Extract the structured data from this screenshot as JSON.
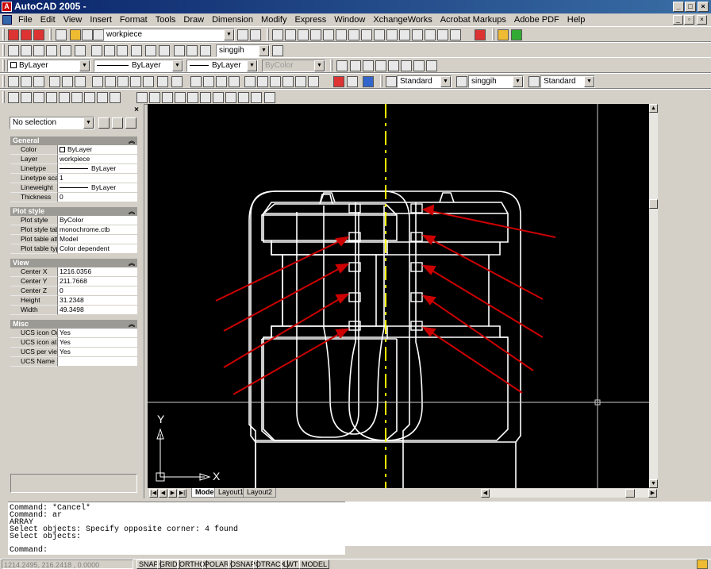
{
  "window": {
    "title": "AutoCAD 2005 -",
    "minimize": "_",
    "maximize": "□",
    "close": "×"
  },
  "menu": [
    "File",
    "Edit",
    "View",
    "Insert",
    "Format",
    "Tools",
    "Draw",
    "Dimension",
    "Modify",
    "Express",
    "Window",
    "XchangeWorks",
    "Acrobat Markups",
    "Adobe PDF",
    "Help"
  ],
  "toolbars": {
    "layer_combo": "workpiece",
    "dimstyle_combo": "singgih",
    "color_combo": "ByLayer",
    "linetype_combo": "ByLayer",
    "lineweight_combo": "ByLayer",
    "plotstyle_combo": "ByColor",
    "textstyle_combo": "Standard",
    "dimstyle2_combo": "singgih",
    "tablestyle_combo": "Standard"
  },
  "properties": {
    "selection": "No selection",
    "close": "×",
    "collapse": "︽",
    "sections": [
      {
        "title": "General",
        "rows": [
          {
            "k": "Color",
            "v": "ByLayer",
            "swatch": true
          },
          {
            "k": "Layer",
            "v": "workpiece"
          },
          {
            "k": "Linetype",
            "v": "ByLayer",
            "line": true
          },
          {
            "k": "Linetype scale",
            "v": "1"
          },
          {
            "k": "Lineweight",
            "v": "ByLayer",
            "line": true
          },
          {
            "k": "Thickness",
            "v": "0"
          }
        ]
      },
      {
        "title": "Plot style",
        "rows": [
          {
            "k": "Plot style",
            "v": "ByColor"
          },
          {
            "k": "Plot style table",
            "v": "monochrome.ctb"
          },
          {
            "k": "Plot table atta...",
            "v": "Model"
          },
          {
            "k": "Plot table type",
            "v": "Color dependent"
          }
        ]
      },
      {
        "title": "View",
        "rows": [
          {
            "k": "Center X",
            "v": "1216.0356"
          },
          {
            "k": "Center Y",
            "v": "211.7668"
          },
          {
            "k": "Center Z",
            "v": "0"
          },
          {
            "k": "Height",
            "v": "31.2348"
          },
          {
            "k": "Width",
            "v": "49.3498"
          }
        ]
      },
      {
        "title": "Misc",
        "rows": [
          {
            "k": "UCS icon On",
            "v": "Yes"
          },
          {
            "k": "UCS icon at ori...",
            "v": "Yes"
          },
          {
            "k": "UCS per viewp...",
            "v": "Yes"
          },
          {
            "k": "UCS Name",
            "v": ""
          }
        ]
      }
    ]
  },
  "drawing": {
    "ucs_x": "X",
    "ucs_y": "Y",
    "colors": {
      "background": "#000000",
      "geometry": "#ffffff",
      "centerline": "#ffff00",
      "arrows": "#cc0000"
    }
  },
  "tabs": [
    "Model",
    "Layout1",
    "Layout2"
  ],
  "command": {
    "history": [
      "Command: *Cancel*",
      "Command: ar",
      "ARRAY",
      "Select objects: Specify opposite corner: 4 found",
      "Select objects:"
    ],
    "prompt": "Command:"
  },
  "status": {
    "coords": "1214.2495, 216.2418 , 0.0000",
    "buttons": [
      "SNAP",
      "GRID",
      "ORTHO",
      "POLAR",
      "OSNAP",
      "OTRACK",
      "LWT",
      "MODEL"
    ]
  }
}
